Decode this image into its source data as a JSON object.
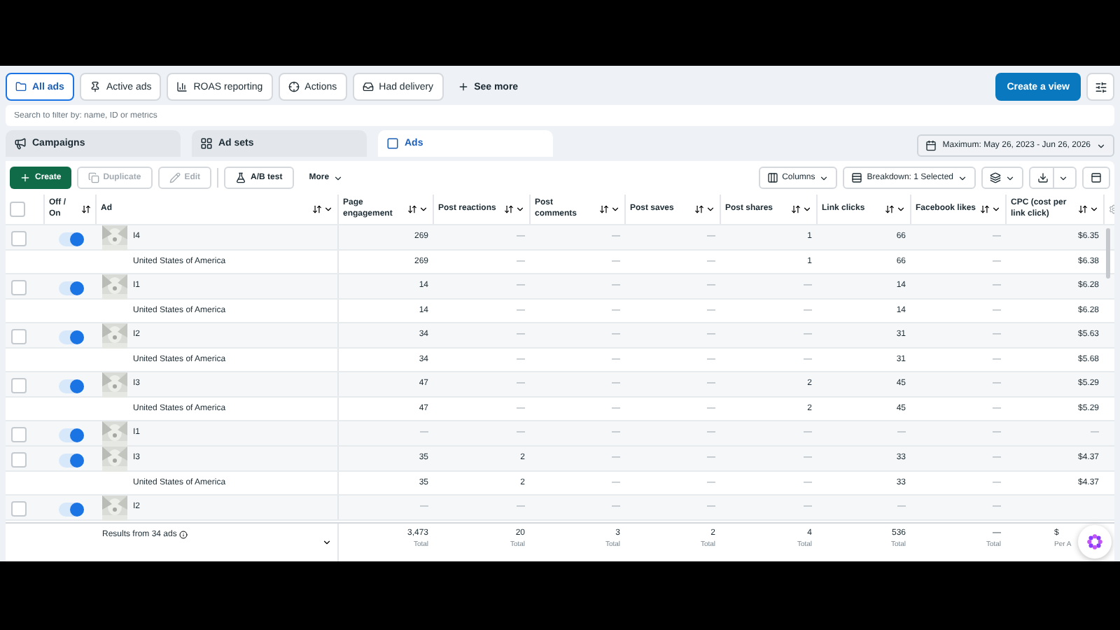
{
  "view_tabs": [
    {
      "label": "All ads",
      "selected": true
    },
    {
      "label": "Active ads",
      "selected": false
    },
    {
      "label": "ROAS reporting",
      "selected": false
    },
    {
      "label": "Actions",
      "selected": false
    },
    {
      "label": "Had delivery",
      "selected": false
    }
  ],
  "see_more": "See more",
  "create_view": "Create a view",
  "search": {
    "placeholder": "Search to filter by: name, ID or metrics"
  },
  "level_tabs": [
    {
      "label": "Campaigns",
      "selected": false
    },
    {
      "label": "Ad sets",
      "selected": false
    },
    {
      "label": "Ads",
      "selected": true
    }
  ],
  "date_range": "Maximum: May 26, 2023 - Jun 26, 2026",
  "actions": [
    {
      "label": "Create",
      "kind": "primary",
      "disabled": false
    },
    {
      "label": "Duplicate",
      "kind": "duplicate",
      "disabled": true
    },
    {
      "label": "Edit",
      "kind": "edit",
      "disabled": true
    },
    {
      "label": "A/B test",
      "kind": "abtest",
      "disabled": false
    },
    {
      "label": "More",
      "kind": "menu",
      "disabled": false
    }
  ],
  "right_actions": {
    "columns": "Columns",
    "breakdown": "Breakdown: 1 Selected"
  },
  "select_all": {
    "checked": false
  },
  "columns": [
    {
      "label": "Off / On",
      "menu": false
    },
    {
      "label": "Ad",
      "menu": true
    },
    {
      "label": "Page engagement",
      "menu": true
    },
    {
      "label": "Post reactions",
      "menu": true
    },
    {
      "label": "Post comments",
      "menu": true
    },
    {
      "label": "Post saves",
      "menu": true
    },
    {
      "label": "Post shares",
      "menu": true
    },
    {
      "label": "Link clicks",
      "menu": true
    },
    {
      "label": "Facebook likes",
      "menu": true
    },
    {
      "label": "CPC (cost per link click)",
      "menu": true
    }
  ],
  "rows": [
    {
      "kind": "ad",
      "name": "I4",
      "checked": false,
      "on": true,
      "values": [
        "269",
        "—",
        "—",
        "—",
        "1",
        "66",
        "—",
        "$6.35"
      ]
    },
    {
      "kind": "breakdown",
      "name": "United States of America",
      "values": [
        "269",
        "—",
        "—",
        "—",
        "1",
        "66",
        "—",
        "$6.38"
      ]
    },
    {
      "kind": "ad",
      "name": "I1",
      "checked": false,
      "on": true,
      "values": [
        "14",
        "—",
        "—",
        "—",
        "—",
        "14",
        "—",
        "$6.28"
      ]
    },
    {
      "kind": "breakdown",
      "name": "United States of America",
      "values": [
        "14",
        "—",
        "—",
        "—",
        "—",
        "14",
        "—",
        "$6.28"
      ]
    },
    {
      "kind": "ad",
      "name": "I2",
      "checked": false,
      "on": true,
      "values": [
        "34",
        "—",
        "—",
        "—",
        "—",
        "31",
        "—",
        "$5.63"
      ]
    },
    {
      "kind": "breakdown",
      "name": "United States of America",
      "values": [
        "34",
        "—",
        "—",
        "—",
        "—",
        "31",
        "—",
        "$5.68"
      ]
    },
    {
      "kind": "ad",
      "name": "I3",
      "checked": false,
      "on": true,
      "values": [
        "47",
        "—",
        "—",
        "—",
        "2",
        "45",
        "—",
        "$5.29"
      ]
    },
    {
      "kind": "breakdown",
      "name": "United States of America",
      "values": [
        "47",
        "—",
        "—",
        "—",
        "2",
        "45",
        "—",
        "$5.29"
      ]
    },
    {
      "kind": "ad",
      "name": "I1",
      "checked": false,
      "on": true,
      "values": [
        "—",
        "—",
        "—",
        "—",
        "—",
        "—",
        "—",
        "—"
      ]
    },
    {
      "kind": "ad",
      "name": "I3",
      "checked": false,
      "on": true,
      "values": [
        "35",
        "2",
        "—",
        "—",
        "—",
        "33",
        "—",
        "$4.37"
      ]
    },
    {
      "kind": "breakdown",
      "name": "United States of America",
      "values": [
        "35",
        "2",
        "—",
        "—",
        "—",
        "33",
        "—",
        "$4.37"
      ]
    },
    {
      "kind": "ad",
      "name": "I2",
      "checked": false,
      "on": true,
      "values": [
        "—",
        "—",
        "—",
        "—",
        "—",
        "—",
        "—"
      ]
    }
  ],
  "footer": {
    "results": "Results from 34 ads",
    "totals": [
      {
        "value": "3,473",
        "label": "Total"
      },
      {
        "value": "20",
        "label": "Total"
      },
      {
        "value": "3",
        "label": "Total"
      },
      {
        "value": "2",
        "label": "Total"
      },
      {
        "value": "4",
        "label": "Total"
      },
      {
        "value": "536",
        "label": "Total"
      },
      {
        "value": "—",
        "label": "Total"
      },
      {
        "value": "$",
        "label": "Per A"
      }
    ]
  }
}
